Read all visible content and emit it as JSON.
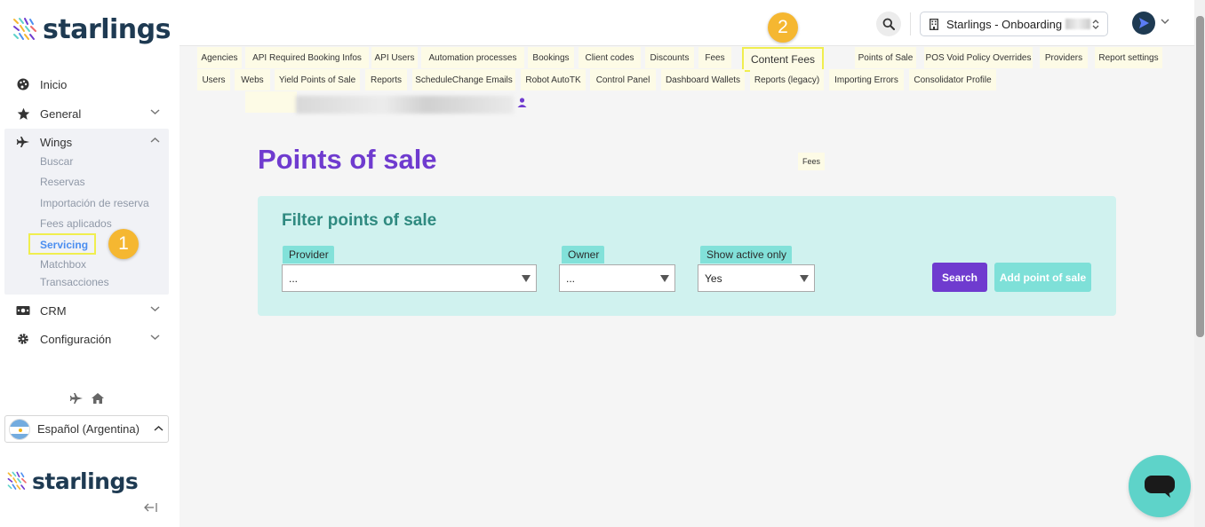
{
  "brand": {
    "name": "starlings",
    "accent": "#6f3bcf",
    "teal": "#5ed3c9",
    "highlight": "#f0ee4f"
  },
  "sidebar": {
    "items": [
      {
        "label": "Inicio",
        "icon": "palette-icon"
      },
      {
        "label": "General",
        "icon": "star-icon"
      },
      {
        "label": "Wings",
        "icon": "plane-icon"
      },
      {
        "label": "CRM",
        "icon": "money-icon"
      },
      {
        "label": "Configuración",
        "icon": "gear-icon"
      }
    ],
    "wings_sub": [
      "Buscar",
      "Reservas",
      "Importación de reserva",
      "Fees aplicados",
      "Servicing",
      "Matchbox",
      "Transacciones"
    ],
    "language": "Español (Argentina)"
  },
  "header": {
    "tenant": "Starlings - Onboarding"
  },
  "tabs": {
    "row1": [
      "Agencies",
      "API Required Booking Infos",
      "API Users",
      "Automation processes",
      "Bookings",
      "Client codes",
      "Discounts",
      "Fees",
      "Content Fees",
      "Points of Sale",
      "POS Void Policy Overrides",
      "Providers",
      "Report settings"
    ],
    "row2": [
      "Users",
      "Webs",
      "Yield Points of Sale",
      "Reports",
      "ScheduleChange Emails",
      "Robot AutoTK",
      "Control Panel",
      "Dashboard Wallets",
      "Reports (legacy)",
      "Importing Errors",
      "Consolidator Profile"
    ]
  },
  "badges": [
    "1",
    "2"
  ],
  "main": {
    "title": "Points of sale",
    "fees_chip": "Fees",
    "filter": {
      "title": "Filter points of sale",
      "provider_label": "Provider",
      "provider_value": "...",
      "owner_label": "Owner",
      "owner_value": "...",
      "active_label": "Show active only",
      "active_value": "Yes",
      "search_label": "Search",
      "add_label": "Add point of sale"
    }
  }
}
